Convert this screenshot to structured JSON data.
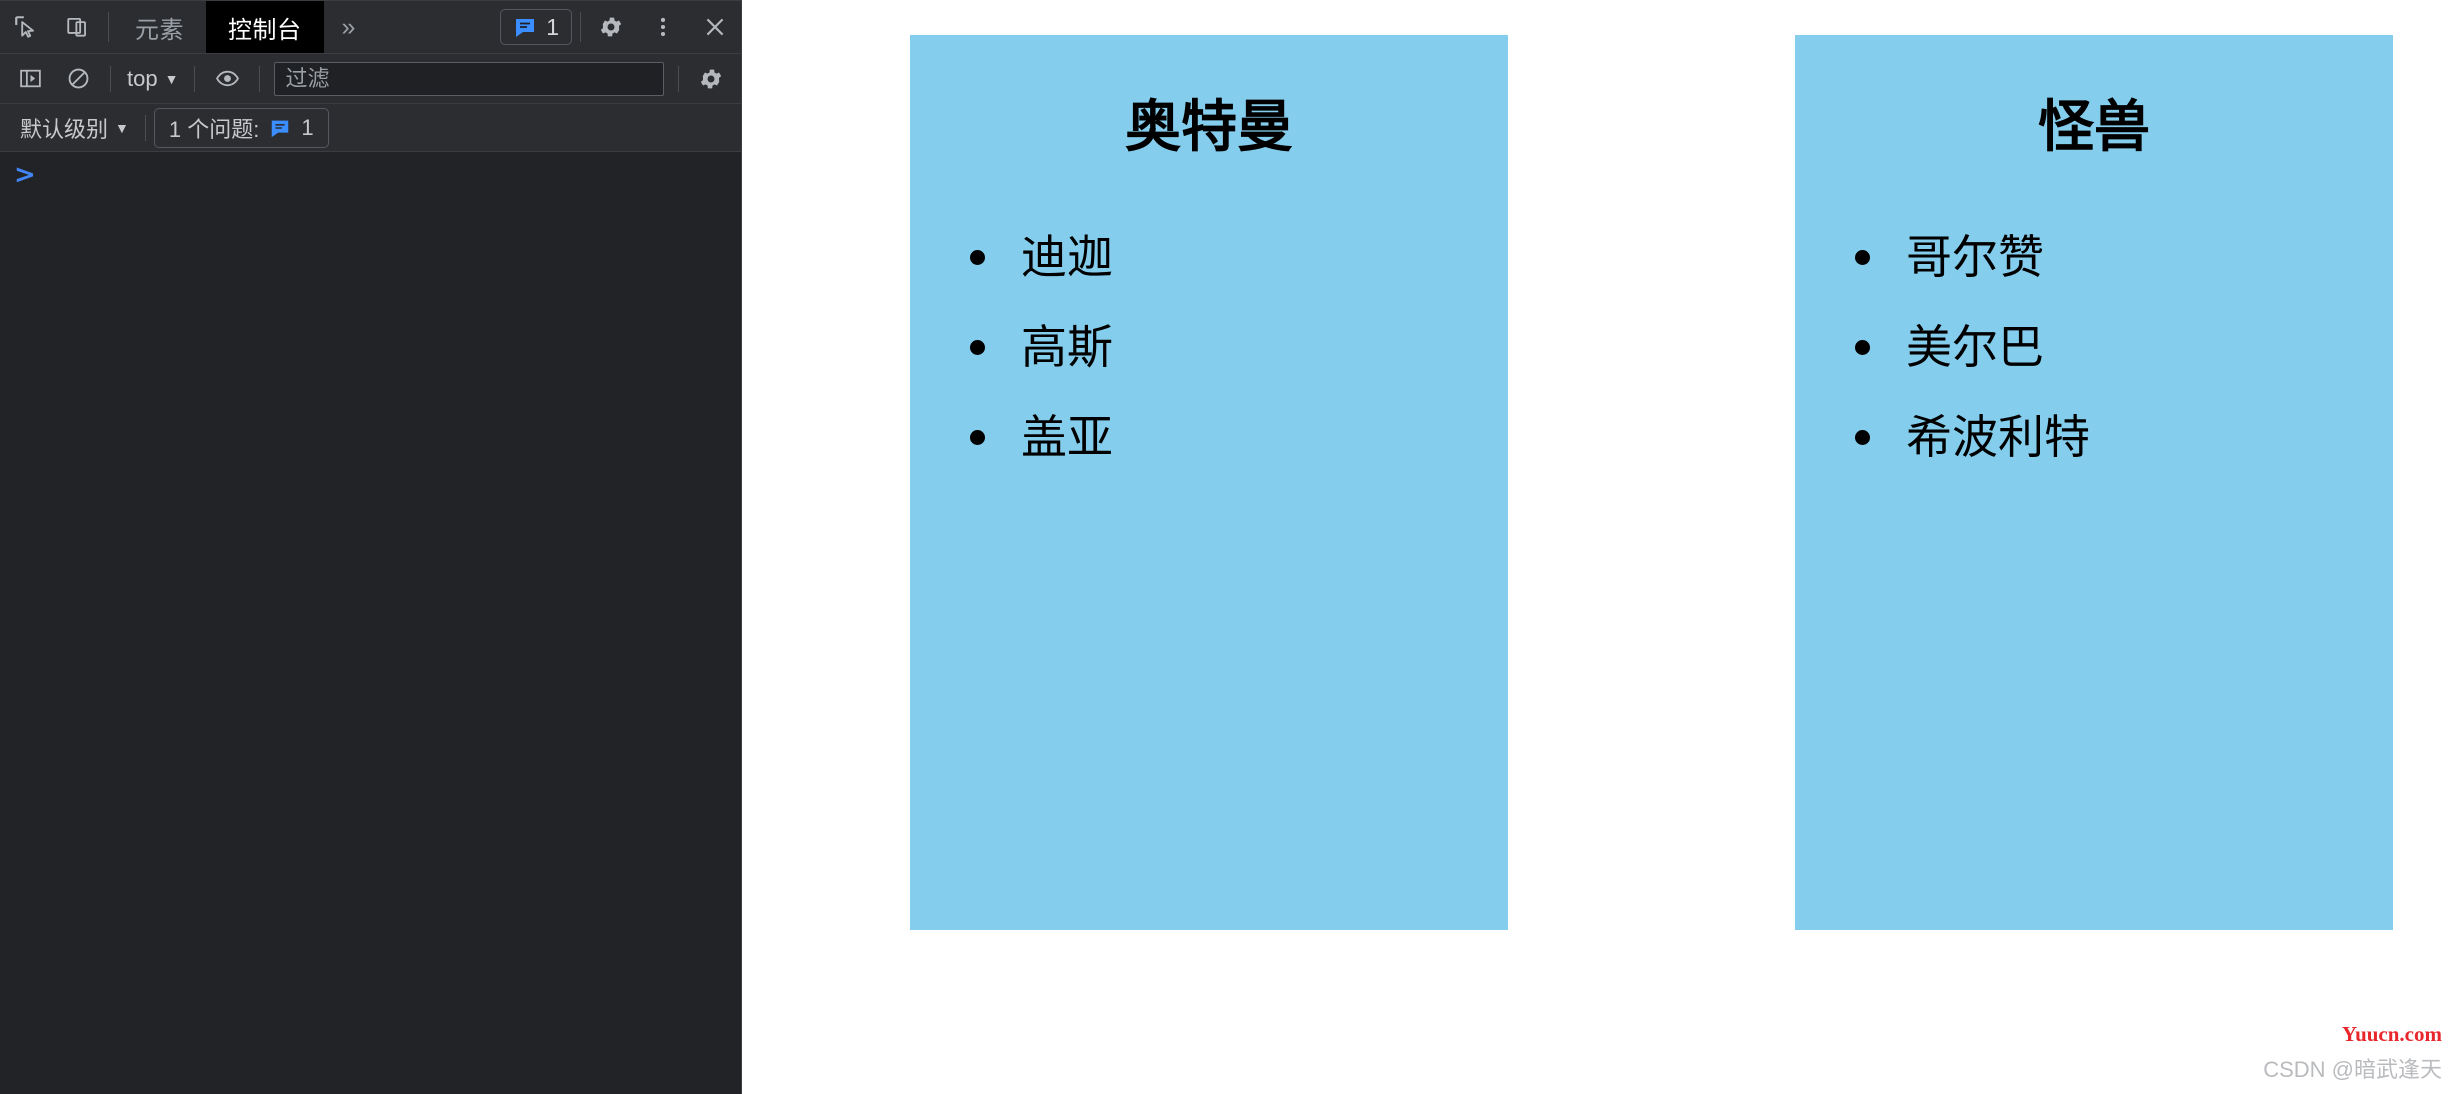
{
  "devtools": {
    "tabbar": {
      "inspect_icon": "inspect-element-icon",
      "device_icon": "device-toolbar-icon",
      "tabs": [
        {
          "label": "元素",
          "name": "tab-elements",
          "active": false
        },
        {
          "label": "控制台",
          "name": "tab-console",
          "active": true
        }
      ],
      "more_tabs": "»",
      "message_count": "1",
      "message_icon": "message-bubble-icon",
      "settings_icon": "gear-icon",
      "kebab_icon": "more-options-icon",
      "close_icon": "close-icon"
    },
    "console_toolbar": {
      "sidebar_icon": "console-sidebar-icon",
      "clear_icon": "clear-console-icon",
      "context": "top",
      "eye_icon": "live-expression-icon",
      "filter_placeholder": "过滤",
      "filter_value": "",
      "settings_icon": "gear-icon"
    },
    "level_bar": {
      "levels": "默认级别",
      "issues_text": "1 个问题:",
      "issues_count": "1",
      "issues_icon": "message-bubble-icon"
    },
    "console_body": {
      "prompt": ">",
      "input_value": ""
    },
    "colors": {
      "panel_bg": "#222326",
      "toolbar_bg": "#2b2d31",
      "active_tab_bg": "#000000",
      "accent_blue": "#4285f4"
    }
  },
  "page": {
    "cards": [
      {
        "title": "奥特曼",
        "items": [
          "迪迦",
          "高斯",
          "盖亚"
        ]
      },
      {
        "title": "怪兽",
        "items": [
          "哥尔赞",
          "美尔巴",
          "希波利特"
        ]
      }
    ],
    "card_bg_color": "#85cdec",
    "watermark_top": "Yuucn.com",
    "watermark_bottom": "CSDN @暗武逢天"
  }
}
